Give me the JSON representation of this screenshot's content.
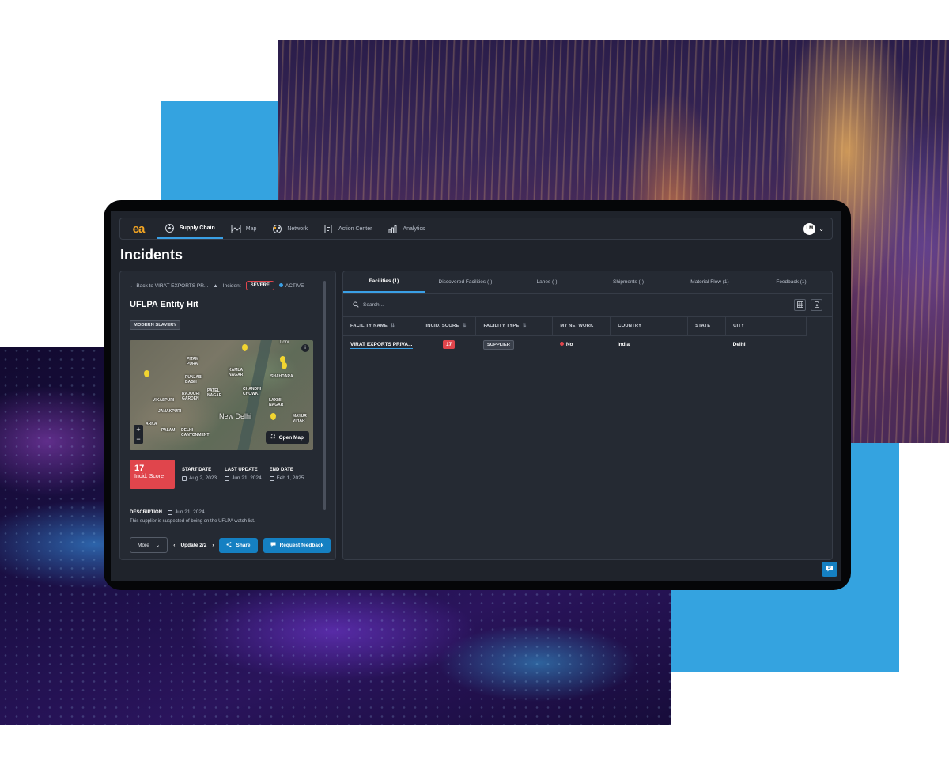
{
  "nav": {
    "items": [
      {
        "label": "Supply Chain",
        "icon": "supply-chain-icon",
        "active": true
      },
      {
        "label": "Map",
        "icon": "map-icon",
        "active": false
      },
      {
        "label": "Network",
        "icon": "network-icon",
        "active": false
      },
      {
        "label": "Action Center",
        "icon": "action-center-icon",
        "active": false
      },
      {
        "label": "Analytics",
        "icon": "analytics-icon",
        "active": false
      }
    ],
    "user_initials": "LM"
  },
  "page_title": "Incidents",
  "incident": {
    "back_label": "Back to VIRAT EXPORTS PR...",
    "type_label": "Incident",
    "severity": "SEVERE",
    "status": "ACTIVE",
    "title": "UFLPA Entity Hit",
    "tag": "MODERN SLAVERY",
    "map": {
      "labels": {
        "loni": "Loni",
        "pitam_pura": "PITAM\nPURA",
        "kamla_nagar": "KAMLA\nNAGAR",
        "shahdara": "SHAHDARA",
        "punjabi_bagh": "PUNJABI\nBAGH",
        "chandni_chowk": "CHANDNI\nCHOWK",
        "rajouri_garden": "RAJOURI\nGARDEN",
        "patel_nagar": "PATEL\nNAGAR",
        "laxmi_nagar": "LAXMI\nNAGAR",
        "vikaspuri": "VIKASPURI",
        "janakpuri": "JANAKPURI",
        "new_delhi": "New Delhi",
        "mayur_vihar": "MAYUR\nVIHAR",
        "palam": "PALAM",
        "delhi_cantonment": "DELHI\nCANTONMENT",
        "arka": "ARKA"
      },
      "zoom_in": "+",
      "zoom_out": "−",
      "open_map_label": "Open Map"
    },
    "score": {
      "value": "17",
      "label": "Incid. Score"
    },
    "dates": [
      {
        "label": "START DATE",
        "value": "Aug 2, 2023"
      },
      {
        "label": "LAST UPDATE",
        "value": "Jun 21, 2024"
      },
      {
        "label": "END DATE",
        "value": "Feb 1, 2025"
      }
    ],
    "description_label": "DESCRIPTION",
    "description_date": "Jun 21, 2024",
    "description_text": "This supplier is suspected of being on the UFLPA watch list.",
    "more_label": "More",
    "update_label": "Update 2/2",
    "share_label": "Share",
    "feedback_label": "Request feedback"
  },
  "tabs": [
    {
      "label": "Facilities (1)",
      "active": true
    },
    {
      "label": "Discovered Facilities (-)",
      "active": false
    },
    {
      "label": "Lanes (-)",
      "active": false
    },
    {
      "label": "Shipments (-)",
      "active": false
    },
    {
      "label": "Material Flow (1)",
      "active": false
    },
    {
      "label": "Feedback (1)",
      "active": false
    }
  ],
  "search_placeholder": "Search...",
  "table": {
    "columns": [
      "FACILITY NAME",
      "INCID. SCORE",
      "FACILITY TYPE",
      "MY NETWORK",
      "COUNTRY",
      "STATE",
      "CITY"
    ],
    "rows": [
      {
        "facility_name": "VIRAT EXPORTS PRIVA...",
        "incid_score": "17",
        "facility_type": "SUPPLIER",
        "my_network": "No",
        "country": "India",
        "state": "",
        "city": "Delhi"
      }
    ]
  },
  "colors": {
    "accent": "#3aa0e6",
    "severe": "#e0454c",
    "primary_button": "#1580c2",
    "logo": "#f5a623",
    "app_background": "#1f232b",
    "backdrop_blue": "#34a3e0"
  }
}
